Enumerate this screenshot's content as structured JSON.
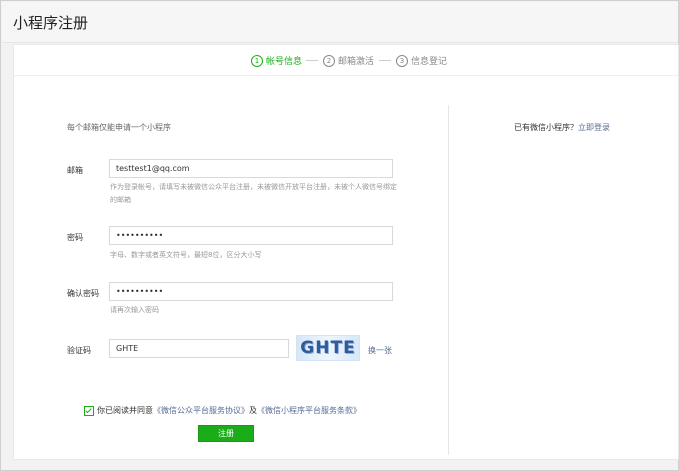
{
  "title": "小程序注册",
  "steps": [
    {
      "num": "1",
      "label": "帐号信息",
      "active": true
    },
    {
      "num": "2",
      "label": "邮箱激活",
      "active": false
    },
    {
      "num": "3",
      "label": "信息登记",
      "active": false
    }
  ],
  "form": {
    "notice": "每个邮箱仅能申请一个小程序",
    "email": {
      "label": "邮箱",
      "value": "testtest1@qq.com",
      "hint": "作为登录帐号，请填写未被微信公众平台注册，未被微信开放平台注册，未被个人微信号绑定的邮箱"
    },
    "password": {
      "label": "密码",
      "value": "••••••••••",
      "hint": "字母、数字或者英文符号，最短8位，区分大小写"
    },
    "confirm_password": {
      "label": "确认密码",
      "value": "••••••••••",
      "hint": "请再次输入密码"
    },
    "captcha": {
      "label": "验证码",
      "value": "GHTE",
      "image_text": "GHTE",
      "refresh": "换一张"
    },
    "agreement": {
      "prefix": "你已阅读并同意",
      "link1": "《微信公众平台服务协议》",
      "and": "及",
      "link2": "《微信小程序平台服务条款》"
    },
    "submit": "注册"
  },
  "sidebar": {
    "text": "已有微信小程序？",
    "link": "立即登录"
  }
}
